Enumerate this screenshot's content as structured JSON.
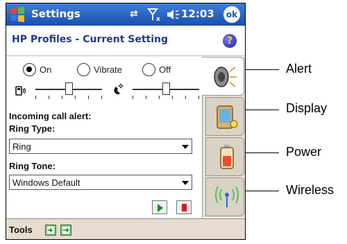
{
  "titlebar": {
    "app_title": "Settings",
    "clock": "12:03",
    "ok_label": "ok"
  },
  "header": {
    "title": "HP Profiles - Current Setting",
    "help_label": "?"
  },
  "ring_mode": {
    "options": [
      "On",
      "Vibrate",
      "Off"
    ],
    "selected": "On"
  },
  "volume": {
    "ringer_level": 0.5,
    "handset_level": 0.5
  },
  "form": {
    "incoming_call_label": "Incoming call alert:",
    "ring_type_label": "Ring Type:",
    "ring_type_value": "Ring",
    "ring_tone_label": "Ring Tone:",
    "ring_tone_value": "Windows Default"
  },
  "tabs": [
    {
      "name": "alert",
      "icon": "speaker-icon",
      "active": true
    },
    {
      "name": "display",
      "icon": "display-icon",
      "active": false
    },
    {
      "name": "power",
      "icon": "battery-icon",
      "active": false
    },
    {
      "name": "wireless",
      "icon": "wireless-icon",
      "active": false
    }
  ],
  "cmdbar": {
    "tools_label": "Tools"
  },
  "callouts": {
    "alert": "Alert",
    "display": "Display",
    "power": "Power",
    "wireless": "Wireless"
  }
}
